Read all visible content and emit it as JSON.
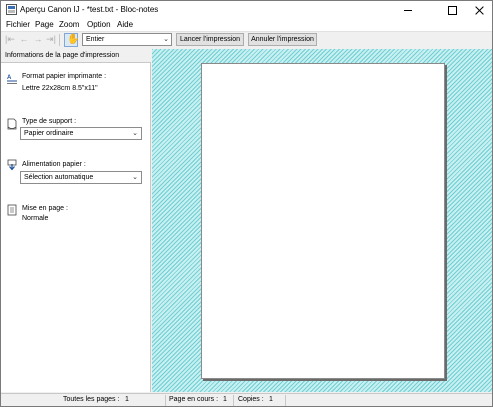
{
  "window": {
    "title": "Aperçu Canon IJ - *test.txt - Bloc-notes"
  },
  "menu": {
    "items": [
      "Fichier",
      "Page",
      "Zoom",
      "Option",
      "Aide"
    ]
  },
  "toolbar": {
    "nav": [
      "|⇤",
      "←",
      "→",
      "⇥|"
    ],
    "zoom_value": "Entier",
    "print_label": "Lancer l'impression",
    "cancel_label": "Annuler l'impression"
  },
  "panel": {
    "header": "Informations de la page d'impression",
    "format_label": "Format papier imprimante :",
    "format_value": "Lettre 22x28cm 8.5\"x11\"",
    "support_label": "Type de support :",
    "support_value": "Papier ordinaire",
    "feed_label": "Alimentation papier :",
    "feed_value": "Sélection automatique",
    "layout_label": "Mise en page :",
    "layout_value": "Normale"
  },
  "status": {
    "total_label": "Toutes les pages :",
    "total_value": "1",
    "current_label": "Page en cours :",
    "current_value": "1",
    "copies_label": "Copies :",
    "copies_value": "1"
  },
  "colors": {
    "preview_bg": "#c8f0f0",
    "hatch": "#6fcfd4",
    "accent": "#3a6fb5"
  }
}
